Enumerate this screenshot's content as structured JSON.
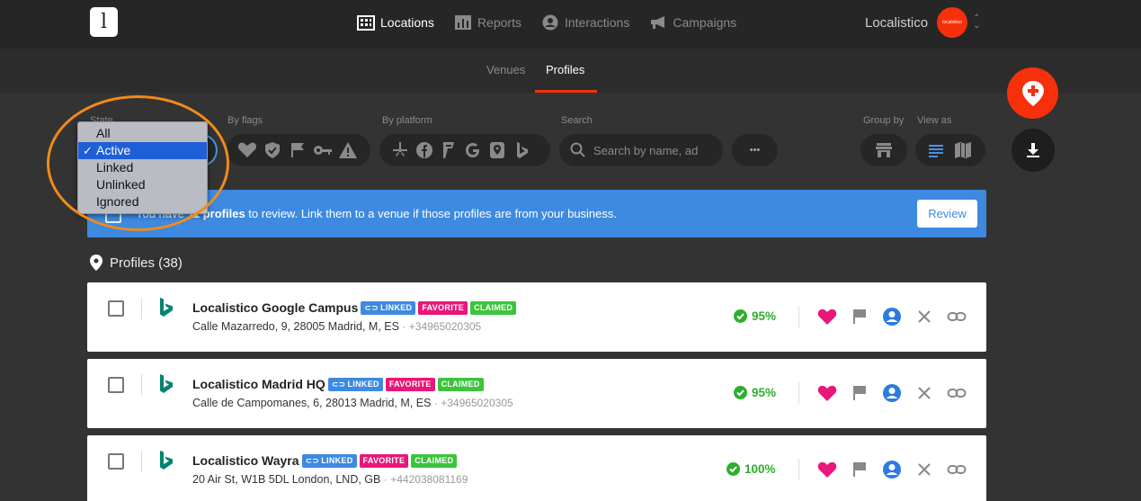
{
  "app": {
    "logo_glyph": "l",
    "account_name": "Localistico",
    "avatar_text": "localistico"
  },
  "nav": [
    {
      "label": "Locations",
      "icon": "building-icon",
      "active": true
    },
    {
      "label": "Reports",
      "icon": "bar-chart-icon",
      "active": false
    },
    {
      "label": "Interactions",
      "icon": "user-circle-icon",
      "active": false
    },
    {
      "label": "Campaigns",
      "icon": "megaphone-icon",
      "active": false
    }
  ],
  "subtabs": [
    {
      "label": "Venues",
      "active": false
    },
    {
      "label": "Profiles",
      "active": true
    }
  ],
  "filters": {
    "state_label": "State",
    "flags_label": "By flags",
    "platform_label": "By platform",
    "search_label": "Search",
    "search_placeholder": "Search by name, ad",
    "group_label": "Group by",
    "view_label": "View as",
    "more_glyph": "•••"
  },
  "state_dropdown": {
    "options": [
      "All",
      "Active",
      "Linked",
      "Unlinked",
      "Ignored"
    ],
    "selected": "Active",
    "check_glyph": "✓"
  },
  "banner": {
    "text_prefix": "You have ",
    "count": "11",
    "bold": " profiles",
    "text_suffix": " to review. Link them to a venue if those profiles are from your business.",
    "button": "Review"
  },
  "section": {
    "title": "Profiles (38)"
  },
  "profiles": [
    {
      "name": "Localistico Google Campus",
      "address": "Calle Mazarredo, 9, 28005 Madrid, M, ES",
      "phone": "+34965020305",
      "score": "95%",
      "tags": [
        "LINKED",
        "FAVORITE",
        "CLAIMED"
      ]
    },
    {
      "name": "Localistico Madrid HQ",
      "address": "Calle de Campomanes, 6, 28013 Madrid, M, ES",
      "phone": "+34965020305",
      "score": "95%",
      "tags": [
        "LINKED",
        "FAVORITE",
        "CLAIMED"
      ]
    },
    {
      "name": "Localistico Wayra",
      "address": "20 Air St, W1B 5DL London, LND, GB",
      "phone": "+442038081169",
      "score": "100%",
      "tags": [
        "LINKED",
        "FAVORITE",
        "CLAIMED"
      ]
    }
  ],
  "phone_sep": "·",
  "colors": {
    "accent": "#f5300b",
    "linked": "#3d8ae0",
    "favorite": "#e8177a",
    "claimed": "#3cc43c",
    "score": "#2eae2e",
    "banner": "#3d8ae0",
    "highlight": "#f08a1c"
  }
}
